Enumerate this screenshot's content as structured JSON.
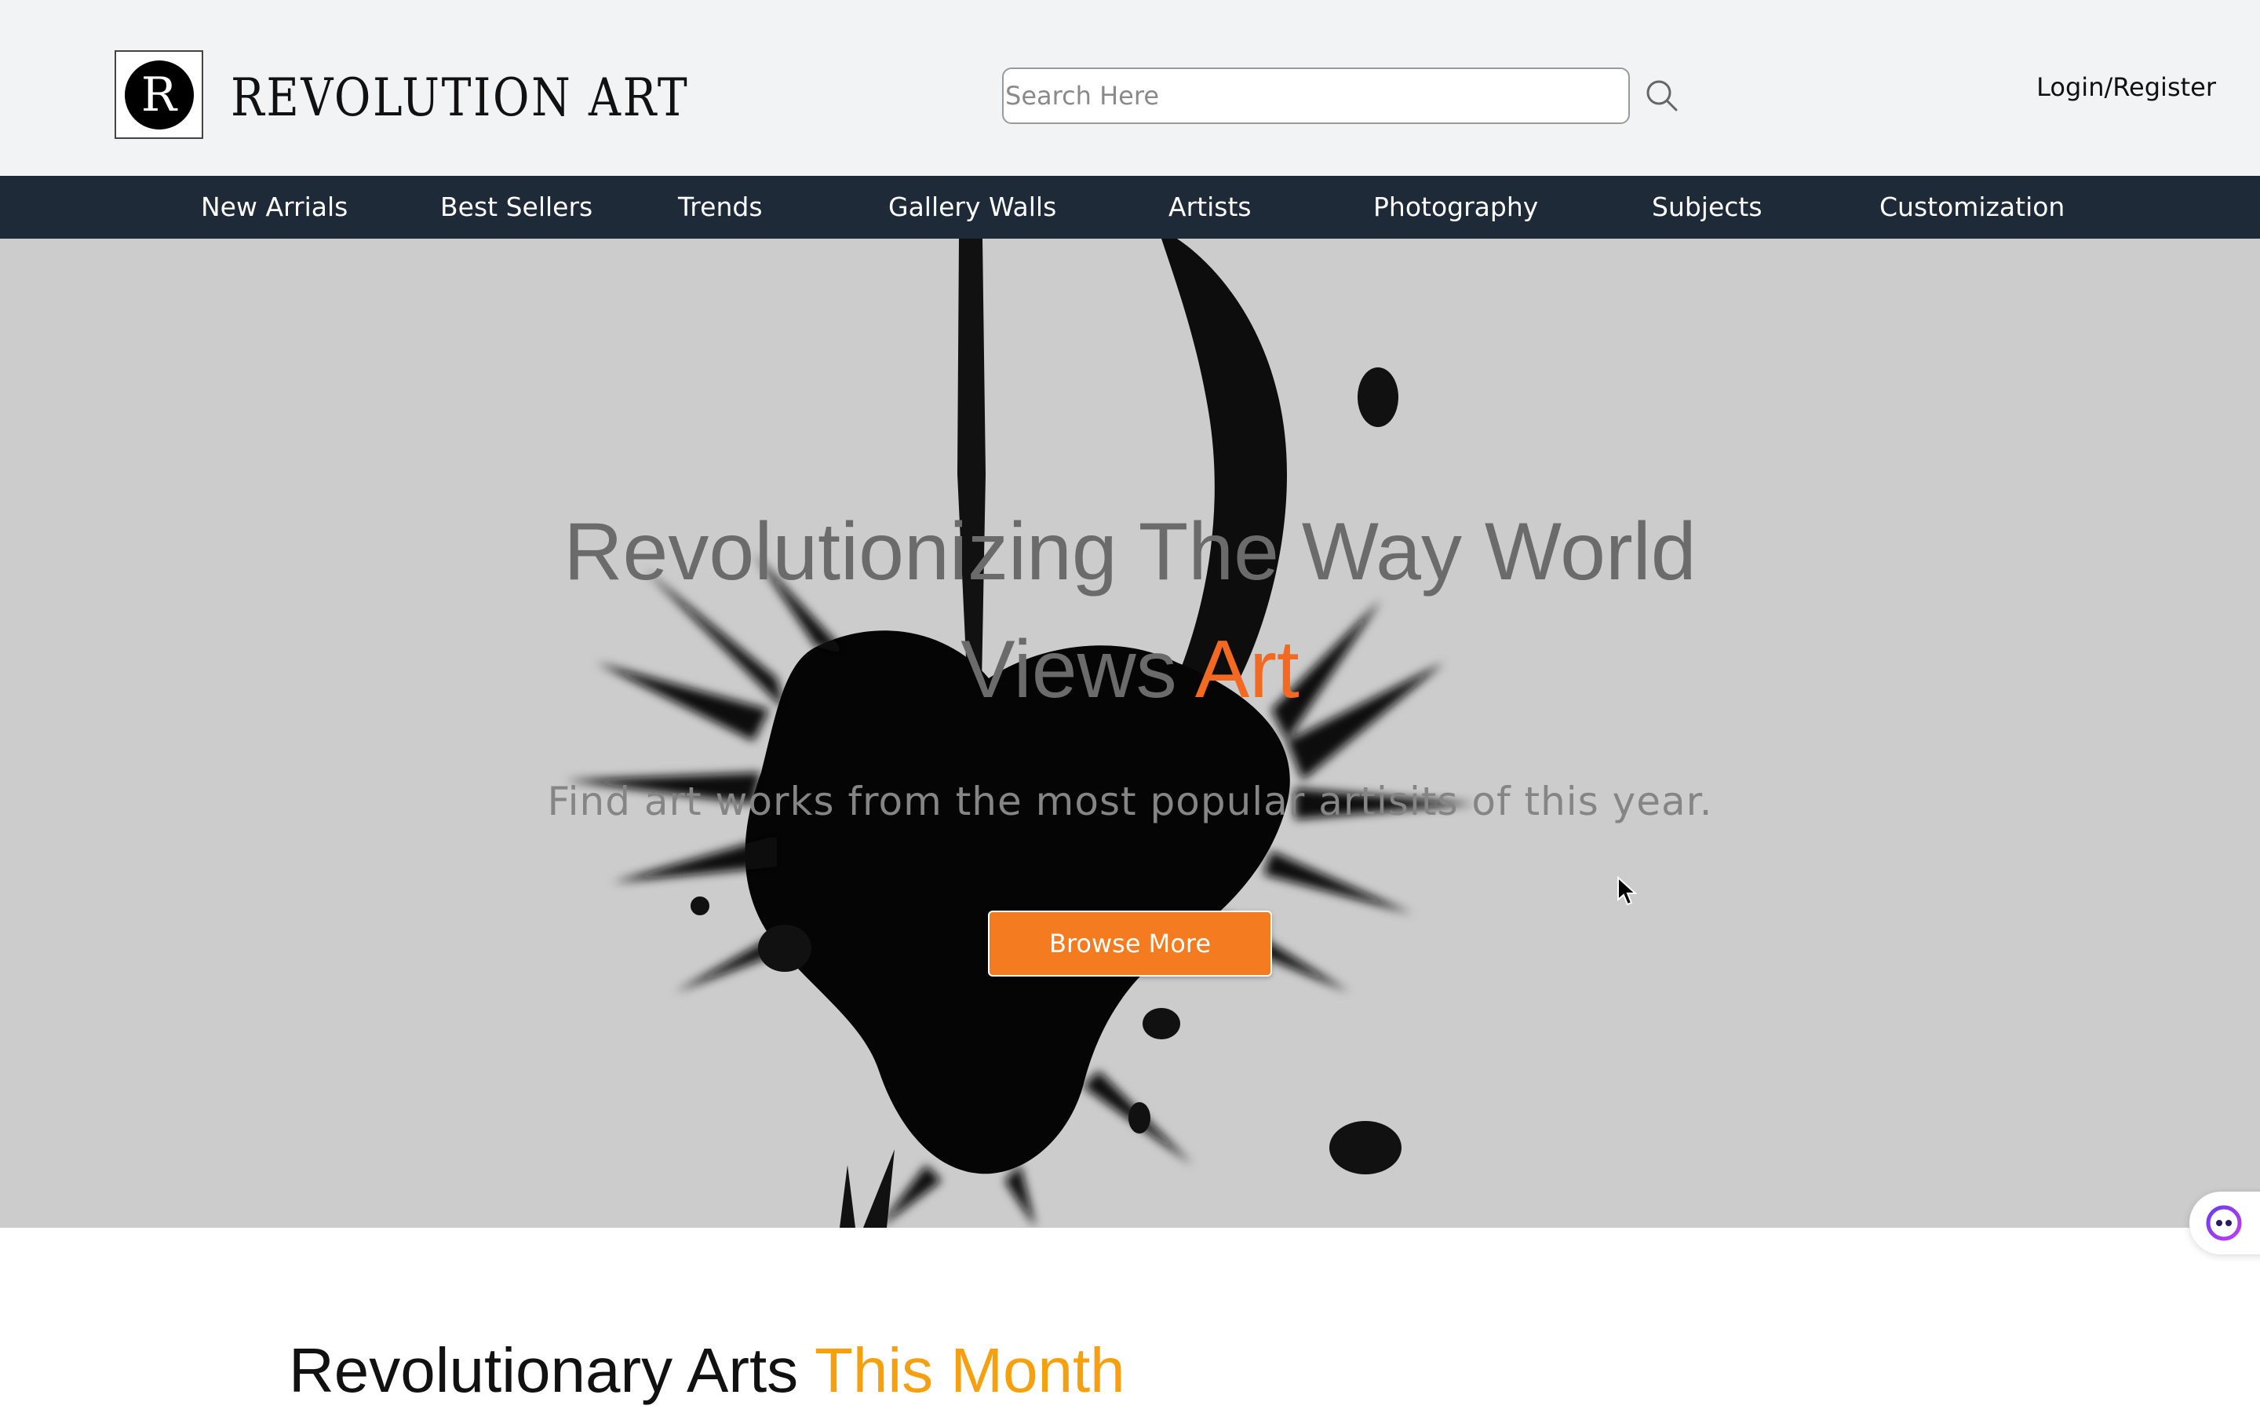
{
  "header": {
    "logo_letter": "R",
    "brand_name": "REVOLUTION ART",
    "search_placeholder": "Search Here",
    "search_icon": "search-icon",
    "login_label": "Login/Register"
  },
  "nav": {
    "items": [
      {
        "label": "New Arrials"
      },
      {
        "label": "Best Sellers"
      },
      {
        "label": "Trends"
      },
      {
        "label": "Gallery Walls"
      },
      {
        "label": "Artists"
      },
      {
        "label": "Photography"
      },
      {
        "label": "Subjects"
      },
      {
        "label": "Customization"
      }
    ]
  },
  "hero": {
    "title_line1": "Revolutionizing The Way World",
    "title_line2_prefix": "Views ",
    "title_line2_accent": "Art",
    "subtitle": "Find art works from the most popular artisits of this year.",
    "button_label": "Browse More"
  },
  "section": {
    "title_prefix": "Revolutionary Arts ",
    "title_accent": "This Month"
  },
  "widgets": {
    "chat_icon": "assistant-face-icon"
  },
  "colors": {
    "header_bg": "#f2f3f5",
    "nav_bg": "#1e2a38",
    "hero_bg": "#cccccc",
    "accent_orange": "#f26a21",
    "button_orange": "#f47b20",
    "section_accent": "#f5a00f"
  }
}
